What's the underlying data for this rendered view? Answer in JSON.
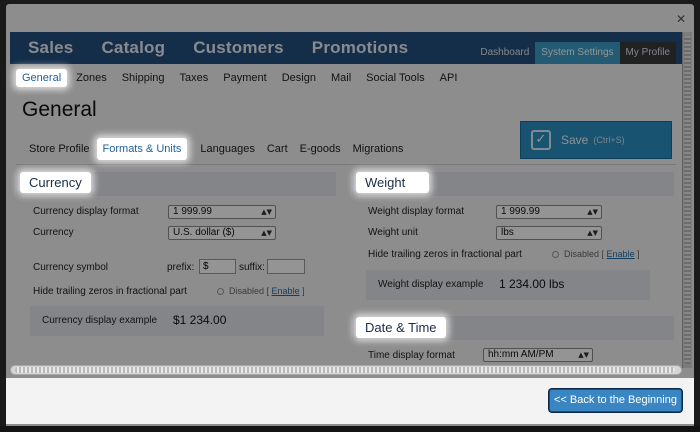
{
  "window": {
    "close_icon": "close-icon"
  },
  "main_nav": [
    "Sales",
    "Catalog",
    "Customers",
    "Promotions"
  ],
  "user_nav": [
    "Dashboard",
    "System Settings",
    "My Profile"
  ],
  "settings_tabs": [
    "General",
    "Zones",
    "Shipping",
    "Taxes",
    "Payment",
    "Design",
    "Mail",
    "Social Tools",
    "API"
  ],
  "page_title": "General",
  "sub_tabs": [
    "Store Profile",
    "Formats & Units",
    "Languages",
    "Cart",
    "E-goods",
    "Migrations"
  ],
  "save": {
    "label": "Save",
    "hint": "(Ctrl+S)",
    "icon": "checkmark-icon"
  },
  "currency": {
    "title": "Currency",
    "display_format_label": "Currency display format",
    "display_format_value": "1 999.99",
    "currency_label": "Currency",
    "currency_value": "U.S. dollar ($)",
    "symbol_label": "Currency symbol",
    "prefix_label": "prefix:",
    "prefix_value": "$",
    "suffix_label": "suffix:",
    "suffix_value": "",
    "trailing_label": "Hide trailing zeros in fractional part",
    "trailing_state": "Disabled",
    "trailing_link": "Enable",
    "example_label": "Currency display example",
    "example_value": "$1 234.00"
  },
  "weight": {
    "title": "Weight",
    "display_format_label": "Weight display format",
    "display_format_value": "1 999.99",
    "unit_label": "Weight unit",
    "unit_value": "lbs",
    "trailing_label": "Hide trailing zeros in fractional part",
    "trailing_state": "Disabled",
    "trailing_link": "Enable",
    "example_label": "Weight display example",
    "example_value": "1 234.00 lbs"
  },
  "datetime": {
    "title": "Date & Time",
    "time_format_label": "Time display format",
    "time_format_value": "hh:mm AM/PM"
  },
  "back_button": "<< Back to the Beginning",
  "colors": {
    "header": "#24507f",
    "accent": "#2c8fc5",
    "active_tab": "#3b9ec7"
  }
}
